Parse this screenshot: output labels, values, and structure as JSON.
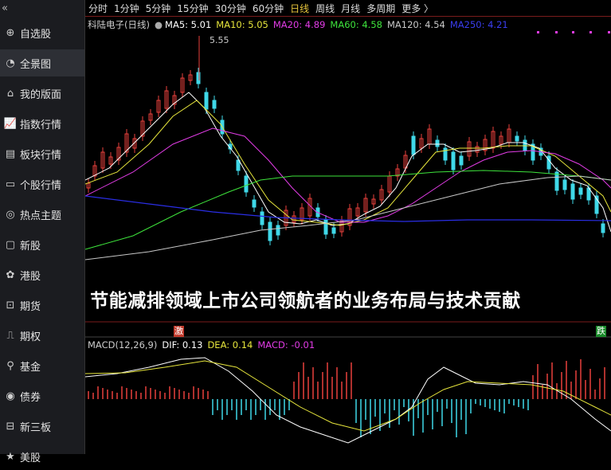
{
  "sidebar": {
    "collapse_icon": "double-chevron-left-icon",
    "items": [
      {
        "label": "自选股",
        "icon": "plus-circle-icon"
      },
      {
        "label": "全景图",
        "icon": "panorama-icon"
      },
      {
        "label": "我的版面",
        "icon": "home-icon"
      },
      {
        "label": "指数行情",
        "icon": "line-chart-icon"
      },
      {
        "label": "板块行情",
        "icon": "blocks-icon"
      },
      {
        "label": "个股行情",
        "icon": "monitor-icon"
      },
      {
        "label": "热点主题",
        "icon": "target-icon"
      },
      {
        "label": "新股",
        "icon": "bag-icon"
      },
      {
        "label": "港股",
        "icon": "bauhinia-icon"
      },
      {
        "label": "期货",
        "icon": "futures-chart-icon"
      },
      {
        "label": "期权",
        "icon": "options-icon"
      },
      {
        "label": "基金",
        "icon": "fund-icon"
      },
      {
        "label": "债券",
        "icon": "bond-icon"
      },
      {
        "label": "新三板",
        "icon": "three-board-icon"
      },
      {
        "label": "美股",
        "icon": "us-stock-icon"
      }
    ]
  },
  "tabs": [
    "分时",
    "1分钟",
    "5分钟",
    "15分钟",
    "30分钟",
    "60分钟",
    "日线",
    "周线",
    "月线",
    "多周期",
    "更多 〉"
  ],
  "active_tab": "日线",
  "ma_legend": {
    "name": "科陆电子(日线)",
    "ma5": "MA5: 5.01",
    "ma10": "MA10: 5.05",
    "ma20": "MA20: 4.89",
    "ma60": "MA60: 4.58",
    "ma120": "MA120: 4.54",
    "ma250": "MA250: 4.21"
  },
  "peak_label": "5.55",
  "overlay_title": "节能减排领域上市公司领航者的业务布局与技术贡献",
  "badge_left": "激",
  "badge_right": "跌",
  "macd_legend": {
    "title": "MACD(12,26,9)",
    "dif": "DIF: 0.13",
    "dea": "DEA: 0.14",
    "macd": "MACD: -0.01"
  },
  "colors": {
    "up": "#e8413c",
    "down": "#3fd8e8",
    "ma5": "#ffffff",
    "ma10": "#e7e63c",
    "ma20": "#e23ce6",
    "ma60": "#3ee43c",
    "ma120": "#c8c8c8",
    "ma250": "#2a2ee6",
    "active_tab": "#e7c53c"
  }
}
